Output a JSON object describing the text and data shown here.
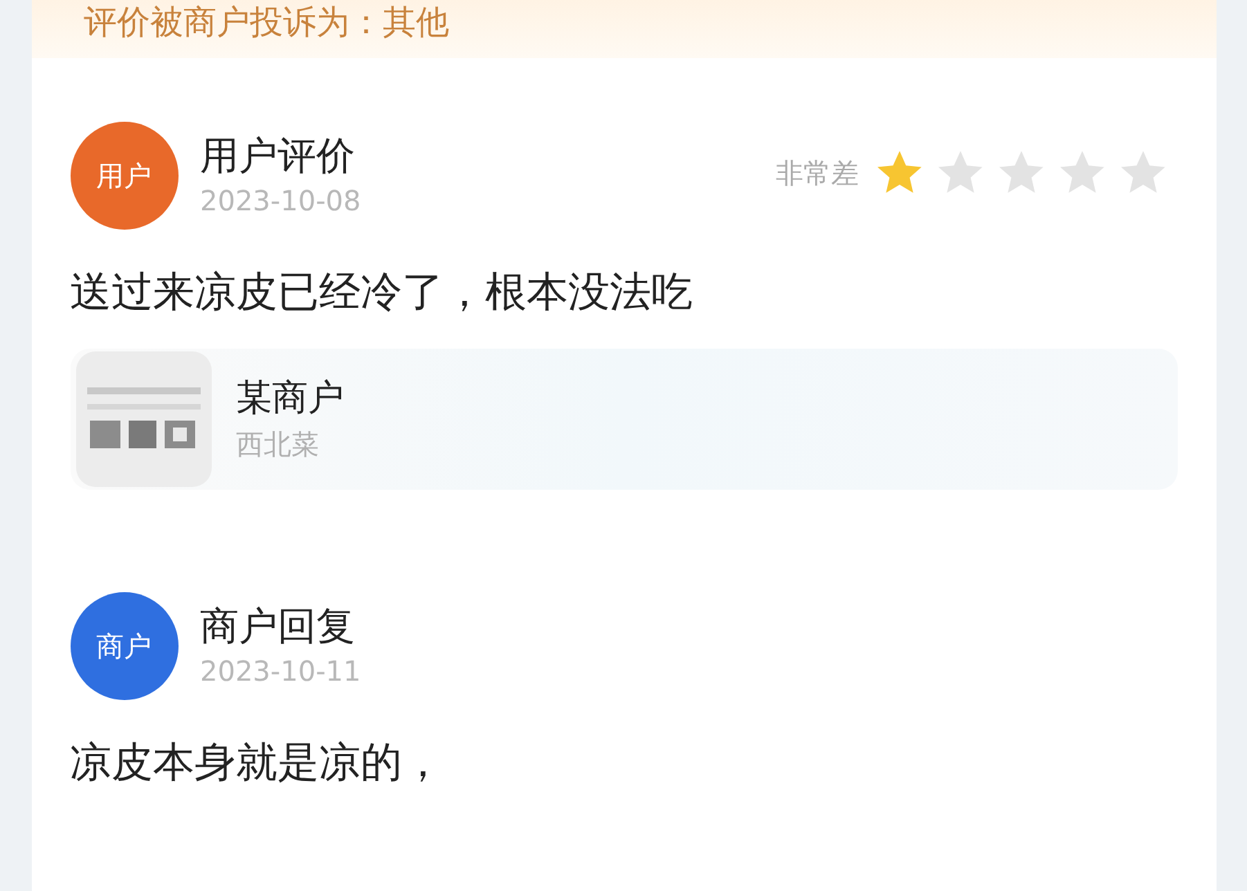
{
  "complaint_banner": {
    "text": "评价被商户投诉为：其他"
  },
  "entries": [
    {
      "kind": "review",
      "avatar": "用户",
      "color": "#e8692a",
      "title": "用户评价",
      "date": "2023-10-08",
      "rating_label": "非常差",
      "stars": 1,
      "text": "送过来凉皮已经冷了，根本没法吃",
      "merchant": {
        "name": "某商户",
        "category": "西北菜"
      }
    },
    {
      "kind": "reply",
      "avatar": "商户",
      "color": "#2f6fe0",
      "title": "商户回复",
      "date": "2023-10-11",
      "text": "凉皮本身就是凉的，"
    }
  ]
}
